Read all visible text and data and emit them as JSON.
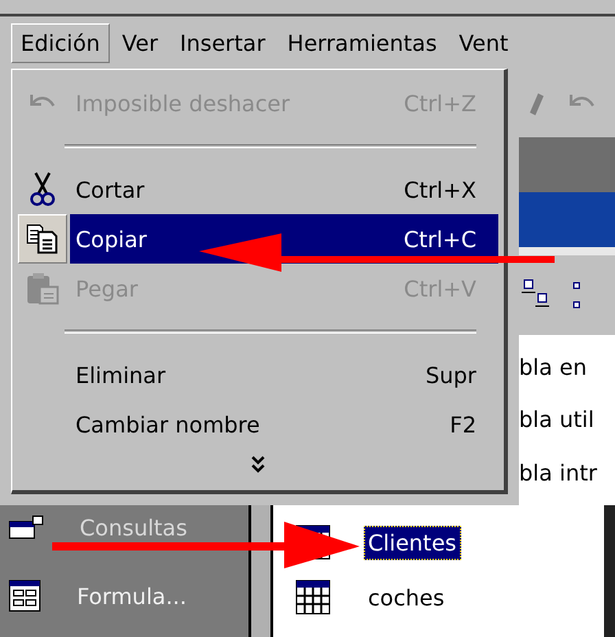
{
  "menubar": [
    {
      "label": "Edición",
      "selected": true
    },
    {
      "label": "Ver",
      "selected": false
    },
    {
      "label": "Insertar",
      "selected": false
    },
    {
      "label": "Herramientas",
      "selected": false
    },
    {
      "label": "Vent",
      "selected": false
    }
  ],
  "menu": {
    "items": [
      {
        "kind": "undo",
        "label": "Imposible deshacer",
        "shortcut": "Ctrl+Z",
        "disabled": true,
        "selected": false
      },
      {
        "kind": "separator"
      },
      {
        "kind": "cut",
        "label": "Cortar",
        "shortcut": "Ctrl+X",
        "disabled": false,
        "selected": false
      },
      {
        "kind": "copy",
        "label": "Copiar",
        "shortcut": "Ctrl+C",
        "disabled": false,
        "selected": true
      },
      {
        "kind": "paste",
        "label": "Pegar",
        "shortcut": "Ctrl+V",
        "disabled": true,
        "selected": false
      },
      {
        "kind": "separator"
      },
      {
        "kind": "plain",
        "label": "Eliminar",
        "shortcut": "Supr",
        "disabled": false,
        "selected": false
      },
      {
        "kind": "plain",
        "label": "Cambiar nombre",
        "shortcut": "F2",
        "disabled": false,
        "selected": false
      },
      {
        "kind": "expand"
      }
    ]
  },
  "create_list": [
    "bla en",
    "bla util",
    "bla intr"
  ],
  "sidebar": {
    "items": [
      {
        "label": "Consultas"
      },
      {
        "label": "Formula..."
      }
    ]
  },
  "objects": [
    {
      "label": "Clientes",
      "selected": true
    },
    {
      "label": "coches",
      "selected": false
    }
  ]
}
